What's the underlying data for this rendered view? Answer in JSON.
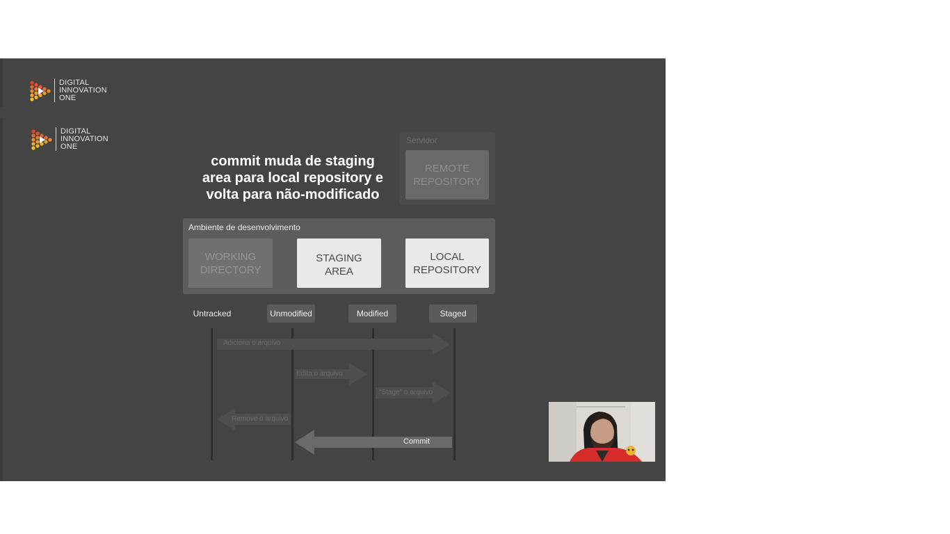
{
  "logo": {
    "line1": "DIGITAL",
    "line2": "INNOVATION",
    "line3": "ONE",
    "icon": "play-hexagon-logo-icon"
  },
  "caption": {
    "line1": "commit muda de staging",
    "line2": "area para local repository e",
    "line3": "volta para não-modificado"
  },
  "server": {
    "label": "Servidor",
    "box_line1": "REMOTE",
    "box_line2": "REPOSITORY"
  },
  "environment": {
    "label": "Ambiente de desenvolvimento",
    "boxes": [
      {
        "line1": "WORKING",
        "line2": "DIRECTORY",
        "highlighted": false
      },
      {
        "line1": "STAGING",
        "line2": "AREA",
        "highlighted": true
      },
      {
        "line1": "LOCAL",
        "line2": "REPOSITORY",
        "highlighted": true
      }
    ]
  },
  "states": [
    "Untracked",
    "Unmodified",
    "Modified",
    "Staged"
  ],
  "transitions": [
    {
      "label": "Adiciona o arquivo",
      "from": "Untracked",
      "to": "Staged"
    },
    {
      "label": "Edita o arquivo",
      "from": "Unmodified",
      "to": "Modified"
    },
    {
      "label": "\"Stage\" o arquivo",
      "from": "Modified",
      "to": "Staged"
    },
    {
      "label": "Remove o arquivo",
      "from": "Unmodified",
      "to": "Untracked"
    },
    {
      "label": "Commit",
      "from": "Staged",
      "to": "Unmodified",
      "active": true
    }
  ],
  "colors": {
    "slide_bg": "#444444",
    "panel_bg": "#5c5c5c",
    "active_box": "#e9e9e9",
    "arrow_dim": "#4e4e4e",
    "arrow_active": "#6a6a6a",
    "logo_orange": "#f08a24",
    "logo_yellow": "#f6c026",
    "logo_red": "#e2452b"
  }
}
